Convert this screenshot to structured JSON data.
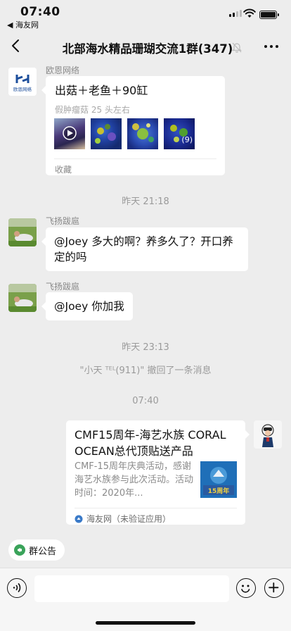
{
  "status_bar": {
    "time": "07:40",
    "back_app": "◀ 海友网"
  },
  "nav": {
    "title": "北部海水精品珊瑚交流1群(347)"
  },
  "messages": {
    "m1": {
      "sender": "欧恩网络",
      "avatar_text": "欧恩网络",
      "card_title": "出菇＋老鱼＋90缸",
      "card_subtitle": "假肿瘤菇 25 头左右",
      "more_count": "(9)",
      "card_footer": "收藏"
    },
    "ts1": "昨天 21:18",
    "m2": {
      "sender": "飞扬跋扈",
      "text": "@Joey 多大的啊？养多久了？开口养定的吗"
    },
    "m3": {
      "sender": "飞扬跋扈",
      "text": "@Joey 你加我"
    },
    "ts2": "昨天 23:13",
    "recall": "\"小天 ᵀᴱᴸ(911)\" 撤回了一条消息",
    "ts3": "07:40",
    "m4": {
      "card_title": "CMF15周年-海艺水族 CORAL OCEAN总代顶贴送产品",
      "card_desc": "CMF-15周年庆典活动，感谢海艺水族参与此次活动。活动时间：2020年...",
      "pic_text": "15周年",
      "source": "海友网（未验证应用）"
    }
  },
  "bottom": {
    "notice_label": "群公告",
    "input_placeholder": ""
  },
  "colors": {
    "background": "#ededed",
    "bubble": "#ffffff",
    "notice_icon": "#3aa35a"
  }
}
